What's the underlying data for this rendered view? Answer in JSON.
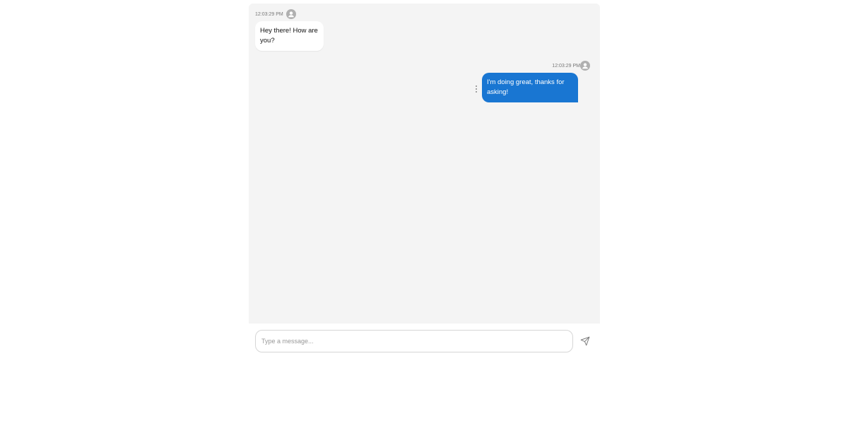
{
  "messages": [
    {
      "direction": "incoming",
      "timestamp": "12:03:29 PM",
      "text": "Hey there! How are you?"
    },
    {
      "direction": "outgoing",
      "timestamp": "12:03:29 PM",
      "text": "I'm doing great, thanks for asking!"
    }
  ],
  "composer": {
    "placeholder": "Type a message...",
    "value": ""
  },
  "icons": {
    "avatar": "user-avatar-icon",
    "more": "more-vertical-icon",
    "send": "send-icon"
  },
  "colors": {
    "outgoing_bubble": "#1976d2",
    "incoming_bubble": "#ffffff",
    "chat_background": "#f4f4f4"
  }
}
